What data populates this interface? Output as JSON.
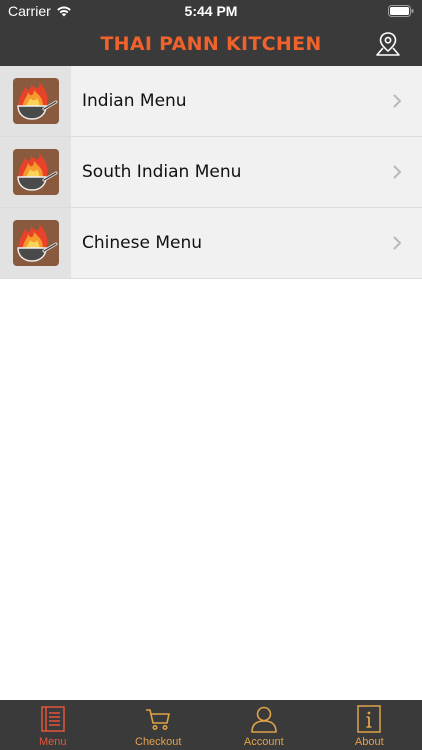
{
  "status_bar": {
    "carrier": "Carrier",
    "time": "5:44 PM"
  },
  "header": {
    "title": "THAI PANN KITCHEN",
    "map_icon": "map-pin-icon"
  },
  "menu": {
    "items": [
      {
        "label": "Indian Menu",
        "icon": "wok-fire-icon"
      },
      {
        "label": "South Indian Menu",
        "icon": "wok-fire-icon"
      },
      {
        "label": "Chinese Menu",
        "icon": "wok-fire-icon"
      }
    ]
  },
  "tab_bar": {
    "tabs": [
      {
        "label": "Menu",
        "icon": "menu-list-icon",
        "active": true
      },
      {
        "label": "Checkout",
        "icon": "cart-icon",
        "active": false
      },
      {
        "label": "Account",
        "icon": "user-icon",
        "active": false
      },
      {
        "label": "About",
        "icon": "info-icon",
        "active": false
      }
    ]
  },
  "colors": {
    "bar_background": "#3a3a3a",
    "brand_orange": "#f0622b",
    "tab_active": "#e4553a",
    "tab_inactive": "#e0a24a"
  }
}
